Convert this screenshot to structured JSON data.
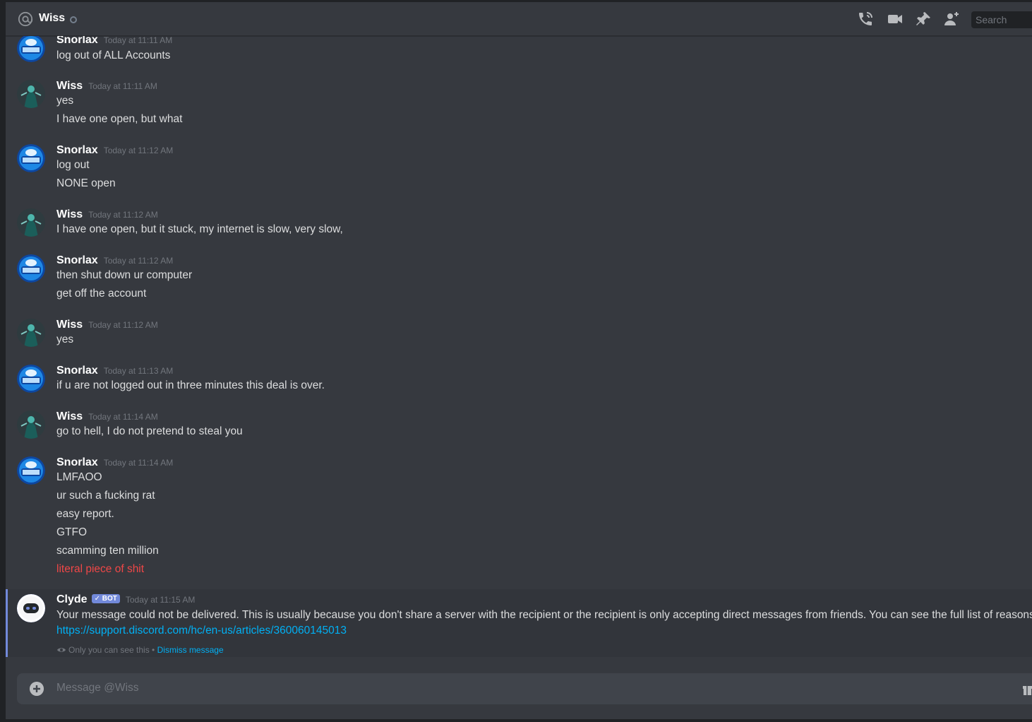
{
  "header": {
    "channel_name": "Wiss",
    "search_placeholder": "Search"
  },
  "messages": [
    {
      "user": "Snorlax",
      "time": "Today at 11:11 AM",
      "lines": [
        "log out of ALL Accounts"
      ]
    },
    {
      "user": "Wiss",
      "time": "Today at 11:11 AM",
      "lines": [
        "yes",
        "I have one open, but what"
      ]
    },
    {
      "user": "Snorlax",
      "time": "Today at 11:12 AM",
      "lines": [
        "log out",
        "NONE open"
      ]
    },
    {
      "user": "Wiss",
      "time": "Today at 11:12 AM",
      "lines": [
        "I have one open, but it stuck, my internet is slow, very slow,"
      ]
    },
    {
      "user": "Snorlax",
      "time": "Today at 11:12 AM",
      "lines": [
        "then shut down ur computer",
        "get off the account"
      ]
    },
    {
      "user": "Wiss",
      "time": "Today at 11:12 AM",
      "lines": [
        "yes"
      ]
    },
    {
      "user": "Snorlax",
      "time": "Today at 11:13 AM",
      "lines": [
        "if u are not logged out in three minutes this deal is over."
      ]
    },
    {
      "user": "Wiss",
      "time": "Today at 11:14 AM",
      "lines": [
        "go to hell, I do not pretend to steal you"
      ]
    },
    {
      "user": "Snorlax",
      "time": "Today at 11:14 AM",
      "lines": [
        "LMFAOO",
        "ur such a fucking rat",
        "easy report.",
        "GTFO",
        "scamming ten million",
        "literal piece of shit"
      ]
    }
  ],
  "clyde": {
    "user": "Clyde",
    "bot_tag": "✓ BOT",
    "time": "Today at 11:15 AM",
    "text": "Your message could not be delivered. This is usually because you don't share a server with the recipient or the recipient is only accepting direct messages from friends. You can see the full list of reasons here:",
    "link": "https://support.discord.com/hc/en-us/articles/360060145013",
    "ephemeral_note": "Only you can see this •",
    "dismiss": "Dismiss message"
  },
  "composer": {
    "placeholder": "Message @Wiss"
  },
  "colors": {
    "accent": "#7289da",
    "link": "#00b0f4",
    "red_text": "#f04747",
    "background": "#36393f"
  },
  "icons": [
    "at-sign-icon",
    "phone-call-icon",
    "video-camera-icon",
    "pin-icon",
    "add-friend-icon",
    "plus-icon",
    "gift-icon",
    "eye-icon"
  ]
}
